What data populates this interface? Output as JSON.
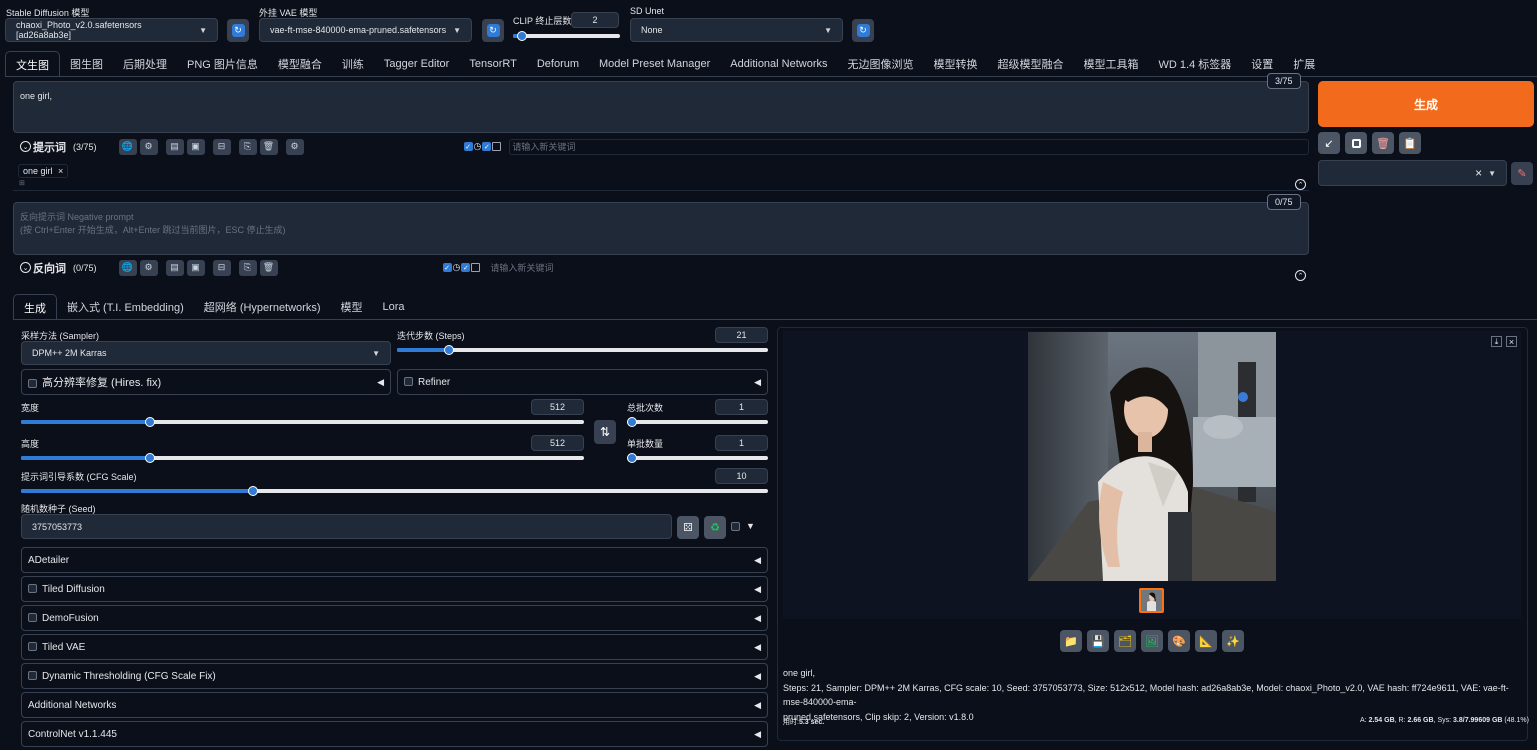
{
  "top": {
    "sd_model_label": "Stable Diffusion 模型",
    "sd_model_value": "chaoxi_Photo_v2.0.safetensors [ad26a8ab3e]",
    "vae_label": "外挂 VAE 模型",
    "vae_value": "vae-ft-mse-840000-ema-pruned.safetensors",
    "clip_label": "CLIP 终止层数",
    "clip_value": "2",
    "clip_level": 0.08,
    "unet_label": "SD Unet",
    "unet_value": "None"
  },
  "tabs": [
    "文生图",
    "图生图",
    "后期处理",
    "PNG 图片信息",
    "模型融合",
    "训练",
    "Tagger Editor",
    "TensorRT",
    "Deforum",
    "Model Preset Manager",
    "Additional Networks",
    "无边图像浏览",
    "模型转换",
    "超级模型融合",
    "模型工具箱",
    "WD 1.4 标签器",
    "设置",
    "扩展"
  ],
  "prompt": {
    "text": "one girl,",
    "counter": "3/75",
    "label": "提示词",
    "count": "(3/75)",
    "keyword_placeholder": "请输入新关键词",
    "tag": "one girl",
    "tag_close": "×",
    "small_mark": "⊞"
  },
  "negative": {
    "placeholder_line1": "反向提示词 Negative prompt",
    "placeholder_line2": "(按 Ctrl+Enter 开始生成，Alt+Enter 跳过当前图片，ESC 停止生成)",
    "counter": "0/75",
    "label": "反向词",
    "count": "(0/75)",
    "keyword_placeholder": "请输入新关键词"
  },
  "right": {
    "generate_label": "生成",
    "arrow_icon": "↙",
    "clear_x": "×"
  },
  "subtabs": [
    "生成",
    "嵌入式 (T.I. Embedding)",
    "超网络 (Hypernetworks)",
    "模型",
    "Lora"
  ],
  "params": {
    "sampler_label": "采样方法 (Sampler)",
    "sampler_value": "DPM++ 2M Karras",
    "steps_label": "迭代步数 (Steps)",
    "steps_value": "21",
    "steps_level": 0.14,
    "hires_label": "高分辨率修复 (Hires. fix)",
    "refiner_label": "Refiner",
    "width_label": "宽度",
    "width_value": "512",
    "width_level": 0.23,
    "height_label": "高度",
    "height_value": "512",
    "height_level": 0.23,
    "batch_count_label": "总批次数",
    "batch_count_value": "1",
    "batch_count_level": 0.0,
    "batch_size_label": "单批数量",
    "batch_size_value": "1",
    "batch_size_level": 0.0,
    "swap_icon": "⇅",
    "cfg_label": "提示词引导系数 (CFG Scale)",
    "cfg_value": "10",
    "cfg_level": 0.31,
    "seed_label": "随机数种子 (Seed)",
    "seed_value": "3757053773",
    "seed_caret": "▼"
  },
  "accordions": [
    "ADetailer",
    "Tiled Diffusion",
    "DemoFusion",
    "Tiled VAE",
    "Dynamic Thresholding (CFG Scale Fix)",
    "Additional Networks",
    "ControlNet v1.1.445"
  ],
  "output": {
    "info_line1": "one girl,",
    "info_line2": "Steps: 21, Sampler: DPM++ 2M Karras, CFG scale: 10, Seed: 3757053773, Size: 512x512, Model hash: ad26a8ab3e, Model: chaoxi_Photo_v2.0, VAE hash: ff724e9611, VAE: vae-ft-mse-840000-ema-",
    "info_line3": "pruned.safetensors, Clip skip: 2, Version: v1.8.0",
    "time_label": "用时:",
    "time_value": "5.3 sec.",
    "mem_prefix": "A: ",
    "mem_a": "2.54 GB",
    "mem_r_prefix": ", R: ",
    "mem_r": "2.66 GB",
    "mem_sys_prefix": ", Sys: ",
    "mem_sys": "3.8/7.99609 GB",
    "mem_pct": " (48.1%)",
    "download_icon": "⤓",
    "close_icon": "×"
  },
  "colors": {
    "accent": "#2f7bd5",
    "generate_bg": "#f26b1d",
    "bg": "#0b0f19",
    "panel": "#1f2937"
  }
}
